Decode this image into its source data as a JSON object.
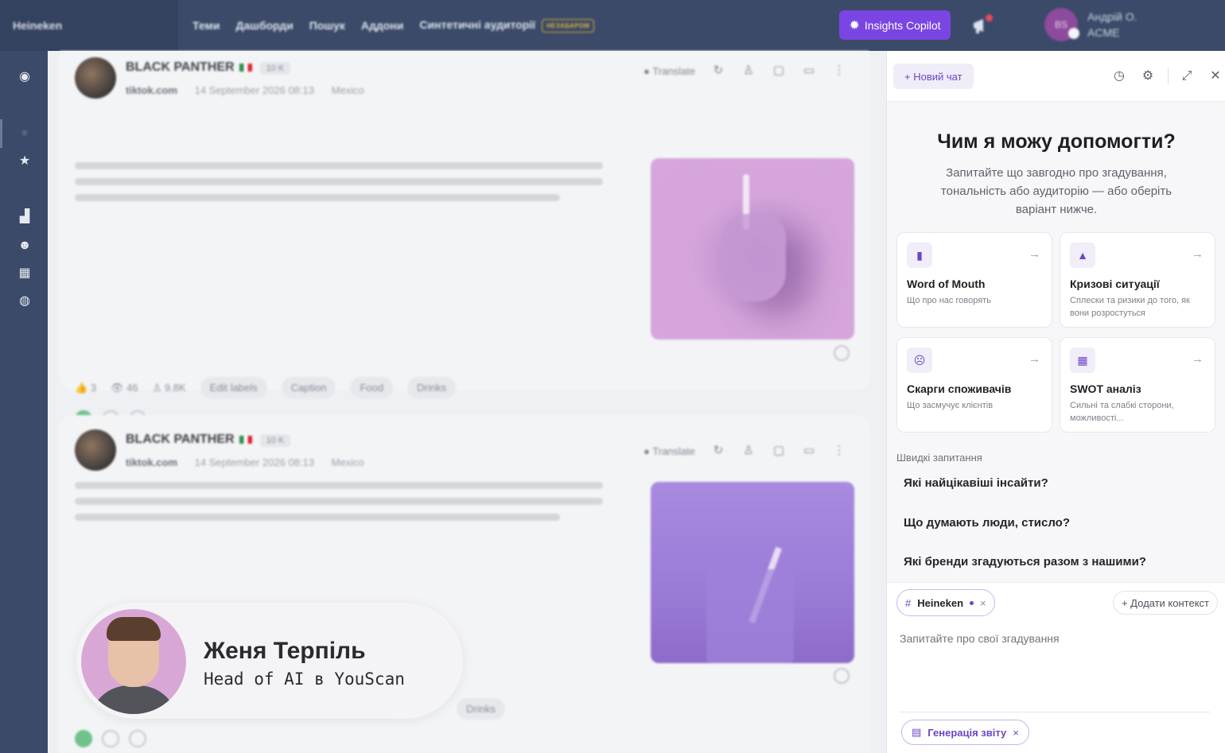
{
  "topbar": {
    "brand": "Heineken",
    "nav": [
      "Теми",
      "Дашборди",
      "Пошук",
      "Аддони",
      "Синтетичні аудиторії"
    ],
    "nav_badge": "НЕЗАБАРОМ",
    "copilot_label": "Insights Copilot",
    "user_initials": "BS",
    "user_name": "Андрій О.",
    "user_org": "ACME",
    "colors": {
      "bar": "#3a4a68",
      "accent": "#7a45e3"
    }
  },
  "sidebar": {
    "icons": [
      "compass-icon",
      "feed-icon",
      "star-icon",
      "chart-icon",
      "audience-icon",
      "dashboard-icon",
      "users-icon"
    ]
  },
  "posts": [
    {
      "author": "BLACK PANTHER",
      "reach": "10 K",
      "source": "tiktok.com",
      "date": "14 September 2026 08:13",
      "location": "Mexico",
      "translate": "Translate",
      "likes": "3",
      "views": "46",
      "audience": "9.8K",
      "chips": [
        "Edit labels",
        "Caption",
        "Food",
        "Drinks"
      ]
    },
    {
      "author": "BLACK PANTHER",
      "reach": "10 K",
      "source": "tiktok.com",
      "date": "14 September 2026 08:13",
      "location": "Mexico",
      "translate": "Translate",
      "chips": [
        "Drinks"
      ]
    }
  ],
  "person": {
    "name": "Женя Терпіль",
    "role": "Head of AI в YouScan"
  },
  "panel": {
    "new_chat": "+ Новий чат",
    "title": "Чим я можу допомогти?",
    "subtitle": "Запитайте що завгодно про згадування, тональність або аудиторію — або оберіть варіант нижче.",
    "cards": [
      {
        "title": "Word of Mouth",
        "desc": "Що про нас говорять",
        "icon": "chat-icon"
      },
      {
        "title": "Кризові ситуації",
        "desc": "Сплески та ризики до того, як вони розростуться",
        "icon": "warning-icon"
      },
      {
        "title": "Скарги споживачів",
        "desc": "Що засмучує клієнтів",
        "icon": "sad-face-icon"
      },
      {
        "title": "SWOT аналіз",
        "desc": "Сильні та слабкі сторони, можливості...",
        "icon": "grid-icon"
      }
    ],
    "quick_header": "Швидкі запитання",
    "quick": [
      "Які найцікавіші інсайти?",
      "Що думають люди, стисло?",
      "Які бренди згадуються разом з нашими?"
    ],
    "context_tag": "Heineken",
    "add_context": "+ Додати контекст",
    "input_placeholder": "Запитайте про свої згадування",
    "report_tag": "Генерація звіту"
  }
}
